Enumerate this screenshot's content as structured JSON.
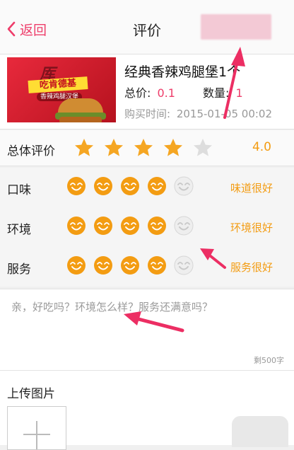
{
  "nav": {
    "back_label": "返回",
    "title": "评价"
  },
  "product": {
    "name": "经典香辣鸡腿堡1个",
    "price_label": "总价:",
    "price_value": "0.1",
    "qty_label": "数量:",
    "qty_value": "1",
    "time_label": "购买时间:",
    "time_value": "2015-01-05 00:02",
    "image_text": {
      "brand": "吃肯德基",
      "subtitle": "香辣鸡腿汉堡"
    }
  },
  "overall": {
    "label": "总体评价",
    "rating": 4,
    "max": 5,
    "score": "4.0"
  },
  "ratings": [
    {
      "label": "口味",
      "value": 4,
      "max": 5,
      "text": "味道很好"
    },
    {
      "label": "环境",
      "value": 4,
      "max": 5,
      "text": "环境很好"
    },
    {
      "label": "服务",
      "value": 4,
      "max": 5,
      "text": "服务很好"
    }
  ],
  "comment": {
    "placeholder": "亲，好吃吗？环境怎么样？服务还满意吗？",
    "remaining": "剩500字"
  },
  "upload": {
    "label": "上传图片"
  },
  "colors": {
    "accent": "#ee3d6a",
    "star": "#f5a623",
    "star_empty": "#dddddd",
    "face": "#f39c12",
    "face_empty": "#eeeeee"
  }
}
